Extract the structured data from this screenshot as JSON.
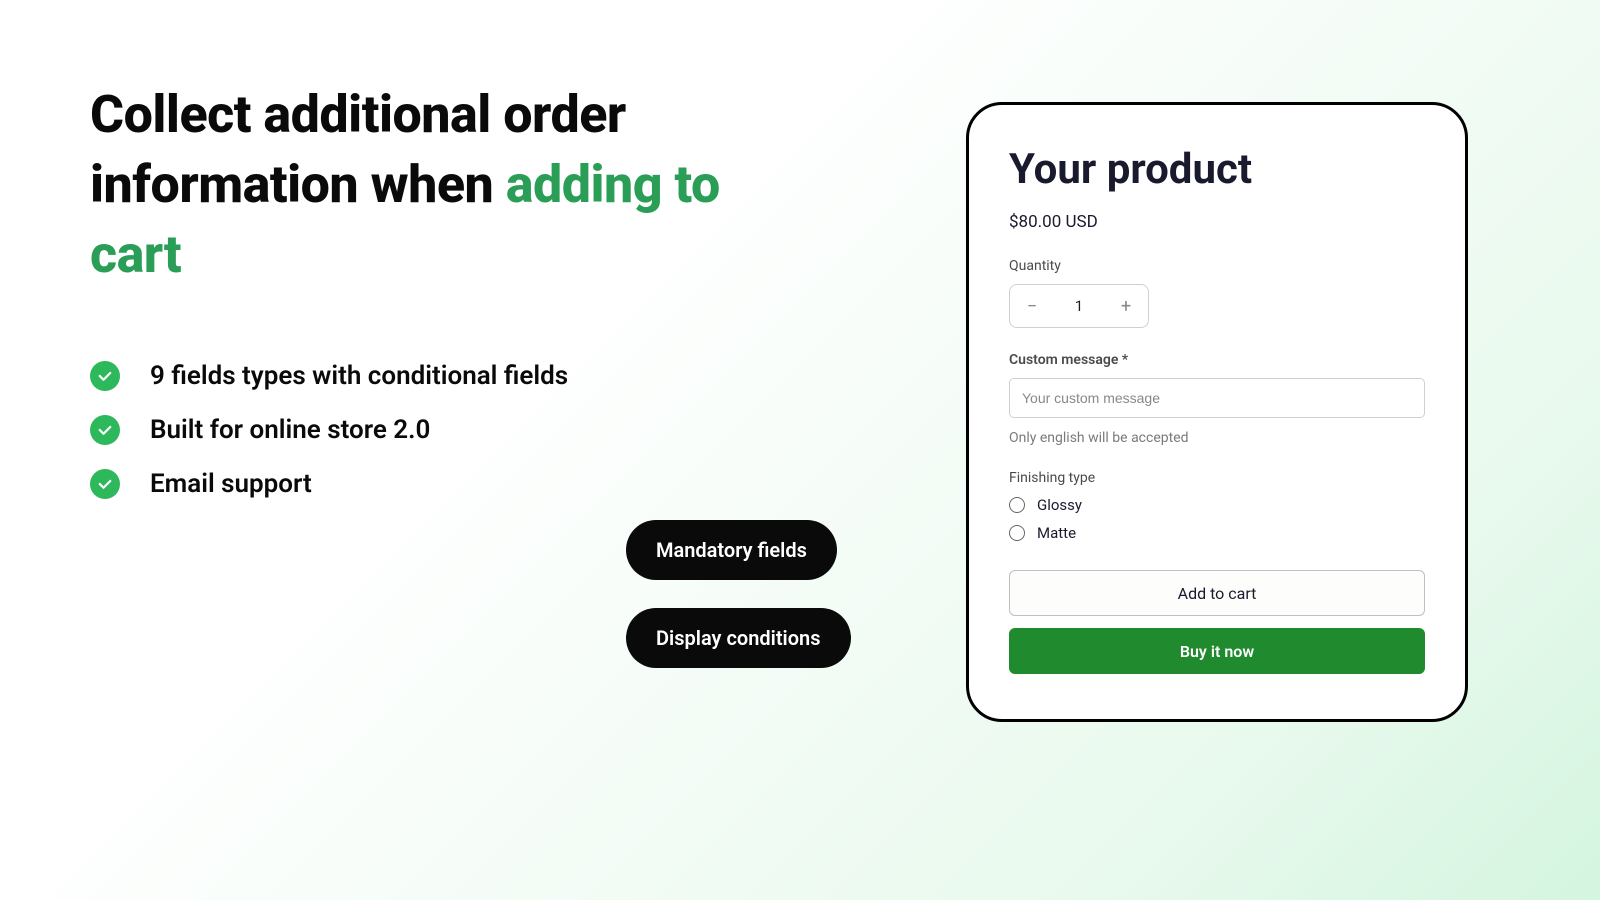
{
  "headline": {
    "part1": "Collect additional order information when ",
    "part2": "adding to cart"
  },
  "bullets": [
    "9 fields types with conditional fields",
    "Built for online store 2.0",
    "Email support"
  ],
  "pills": {
    "mandatory": "Mandatory fields",
    "conditions": "Display conditions"
  },
  "product": {
    "title": "Your product",
    "price": "$80.00 USD",
    "quantity_label": "Quantity",
    "quantity_value": "1",
    "custom_message_label": "Custom message *",
    "custom_message_placeholder": "Your custom message",
    "custom_message_helper": "Only english will be accepted",
    "finishing_label": "Finishing type",
    "finishing_options": [
      "Glossy",
      "Matte"
    ],
    "add_to_cart": "Add to cart",
    "buy_now": "Buy it now"
  }
}
